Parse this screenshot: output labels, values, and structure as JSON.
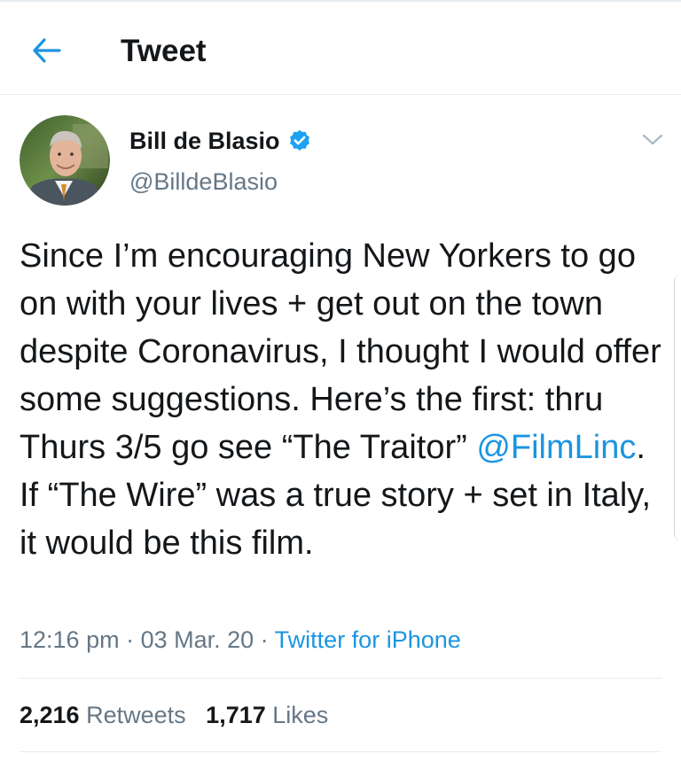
{
  "header": {
    "title": "Tweet",
    "back_icon": "arrow-left-icon"
  },
  "tweet": {
    "author": {
      "display_name": "Bill de Blasio",
      "handle": "@BilldeBlasio",
      "verified": true,
      "verified_icon": "verified-badge-icon"
    },
    "menu_icon": "chevron-down-icon",
    "text_before_mention": "Since I’m encouraging New Yorkers to go on with your lives + get out on the town despite Coronavirus, I thought I would offer some suggestions. Here’s the first: thru Thurs 3/5 go see “The Traitor” ",
    "mention": "@FilmLinc",
    "text_after_mention": ". If “The Wire” was a true story + set in Italy, it would be this film.",
    "time": "12:16 pm",
    "date": "03 Mar. 20",
    "separator": " · ",
    "source": "Twitter for iPhone"
  },
  "stats": {
    "retweets_count": "2,216",
    "retweets_label": "Retweets",
    "likes_count": "1,717",
    "likes_label": "Likes"
  },
  "colors": {
    "accent": "#1b95e0",
    "text": "#14171a",
    "secondary": "#657786",
    "divider": "#e6ecf0"
  }
}
